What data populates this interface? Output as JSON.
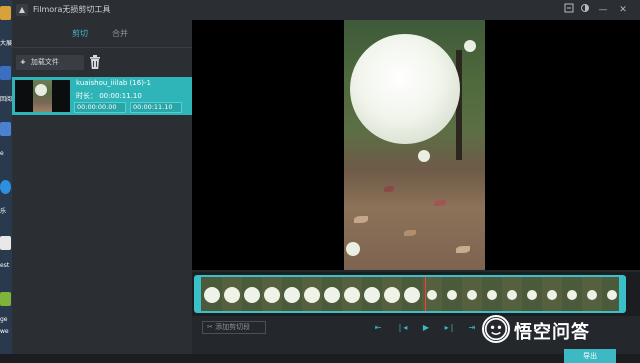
{
  "window": {
    "title": "Filmora无损剪切工具"
  },
  "desktop": {
    "labels": [
      "大展",
      "回阅",
      "e",
      "乐",
      "est",
      "ge",
      "we"
    ]
  },
  "tabs": {
    "trim": "剪切",
    "merge": "合并"
  },
  "toolbar": {
    "add_file": "加载文件"
  },
  "clip": {
    "name": "kuaishou_iiilab (16)-1",
    "duration": "时长：  00:00:11.10",
    "start": "00:00:00.00",
    "end": "00:00:11.10"
  },
  "controls": {
    "add_cut": "添加剪切段",
    "export": "导出"
  },
  "watermark": {
    "text": "悟空问答"
  },
  "colors": {
    "accent": "#3db9c4",
    "clip_bg": "#2fb5b8",
    "playhead": "#ff3b3b"
  },
  "icons": [
    "plus-icon",
    "trash-icon",
    "prev-mark-icon",
    "step-back-icon",
    "play-icon",
    "step-forward-icon",
    "next-mark-icon"
  ]
}
